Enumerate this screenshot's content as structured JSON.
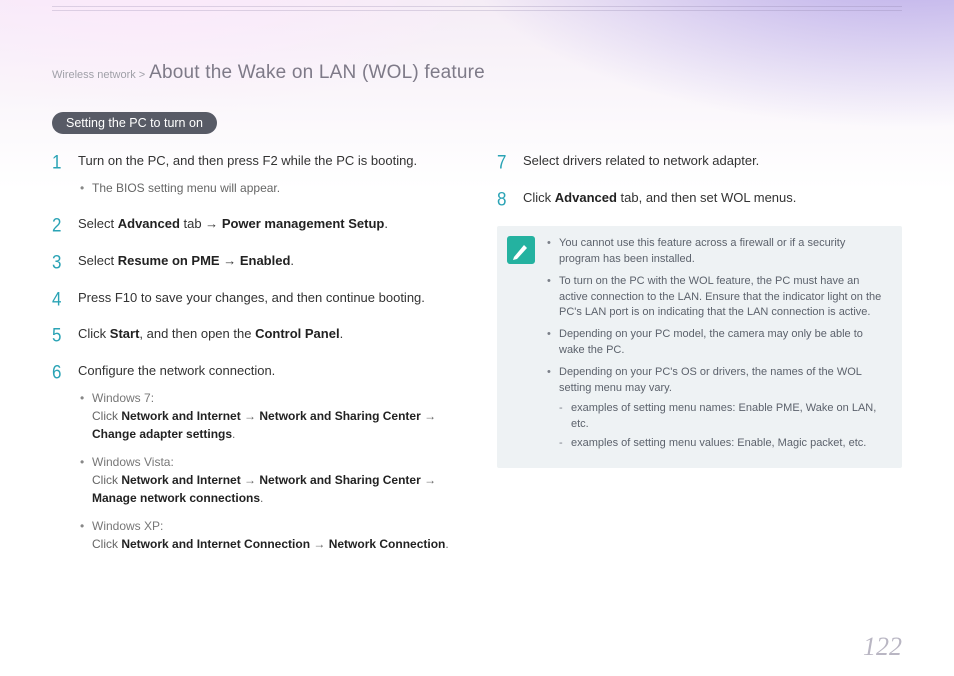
{
  "breadcrumb": {
    "section": "Wireless network >",
    "title": "About the Wake on LAN (WOL) feature"
  },
  "pill": "Setting the PC to turn on",
  "left_steps": [
    {
      "n": "1",
      "html": [
        [
          "t",
          "Turn on the PC, and then press F2 while the PC is booting."
        ]
      ],
      "sub": [
        {
          "html": [
            [
              "t",
              "The BIOS setting menu will appear."
            ]
          ]
        }
      ]
    },
    {
      "n": "2",
      "html": [
        [
          "t",
          "Select "
        ],
        [
          "b",
          "Advanced"
        ],
        [
          "t",
          " tab → "
        ],
        [
          "b",
          "Power management Setup"
        ],
        [
          "t",
          "."
        ]
      ]
    },
    {
      "n": "3",
      "html": [
        [
          "t",
          "Select "
        ],
        [
          "b",
          "Resume on PME"
        ],
        [
          "t",
          " → "
        ],
        [
          "b",
          "Enabled"
        ],
        [
          "t",
          "."
        ]
      ]
    },
    {
      "n": "4",
      "html": [
        [
          "t",
          "Press F10 to save your changes, and then continue booting."
        ]
      ]
    },
    {
      "n": "5",
      "html": [
        [
          "t",
          "Click "
        ],
        [
          "b",
          "Start"
        ],
        [
          "t",
          ", and then open the "
        ],
        [
          "b",
          "Control Panel"
        ],
        [
          "t",
          "."
        ]
      ]
    },
    {
      "n": "6",
      "html": [
        [
          "t",
          "Configure the network connection."
        ]
      ],
      "sub": [
        {
          "lead": "Windows 7:",
          "html": [
            [
              "t",
              "Click "
            ],
            [
              "b",
              "Network and Internet"
            ],
            [
              "t",
              " → "
            ],
            [
              "b",
              "Network and Sharing Center"
            ],
            [
              "t",
              " → "
            ],
            [
              "b",
              "Change adapter settings"
            ],
            [
              "t",
              "."
            ]
          ]
        },
        {
          "lead": "Windows Vista:",
          "html": [
            [
              "t",
              "Click "
            ],
            [
              "b",
              "Network and Internet"
            ],
            [
              "t",
              " → "
            ],
            [
              "b",
              "Network and Sharing Center"
            ],
            [
              "t",
              " → "
            ],
            [
              "b",
              "Manage network connections"
            ],
            [
              "t",
              "."
            ]
          ]
        },
        {
          "lead": "Windows XP:",
          "html": [
            [
              "t",
              "Click "
            ],
            [
              "b",
              "Network and Internet Connection"
            ],
            [
              "t",
              " → "
            ],
            [
              "b",
              "Network Connection"
            ],
            [
              "t",
              "."
            ]
          ]
        }
      ]
    }
  ],
  "right_steps": [
    {
      "n": "7",
      "html": [
        [
          "t",
          "Select drivers related to network adapter."
        ]
      ]
    },
    {
      "n": "8",
      "html": [
        [
          "t",
          "Click "
        ],
        [
          "b",
          "Advanced"
        ],
        [
          "t",
          " tab, and then set WOL menus."
        ]
      ]
    }
  ],
  "notes": [
    {
      "html": [
        [
          "t",
          "You cannot use this feature across a firewall or if a security program has been installed."
        ]
      ]
    },
    {
      "html": [
        [
          "t",
          "To turn on the PC with the WOL feature, the PC must have an active connection to the LAN. Ensure that the indicator light on the PC's LAN port is on indicating that the LAN connection is active."
        ]
      ]
    },
    {
      "html": [
        [
          "t",
          "Depending on your PC model, the camera may only be able to wake the PC."
        ]
      ]
    },
    {
      "html": [
        [
          "t",
          "Depending on your PC's OS or drivers, the names of the WOL setting menu may vary."
        ]
      ],
      "children": [
        {
          "html": [
            [
              "t",
              "examples of setting menu names: Enable PME, Wake on LAN, etc."
            ]
          ]
        },
        {
          "html": [
            [
              "t",
              "examples of setting menu values: Enable, Magic packet, etc."
            ]
          ]
        }
      ]
    }
  ],
  "page_number": "122"
}
